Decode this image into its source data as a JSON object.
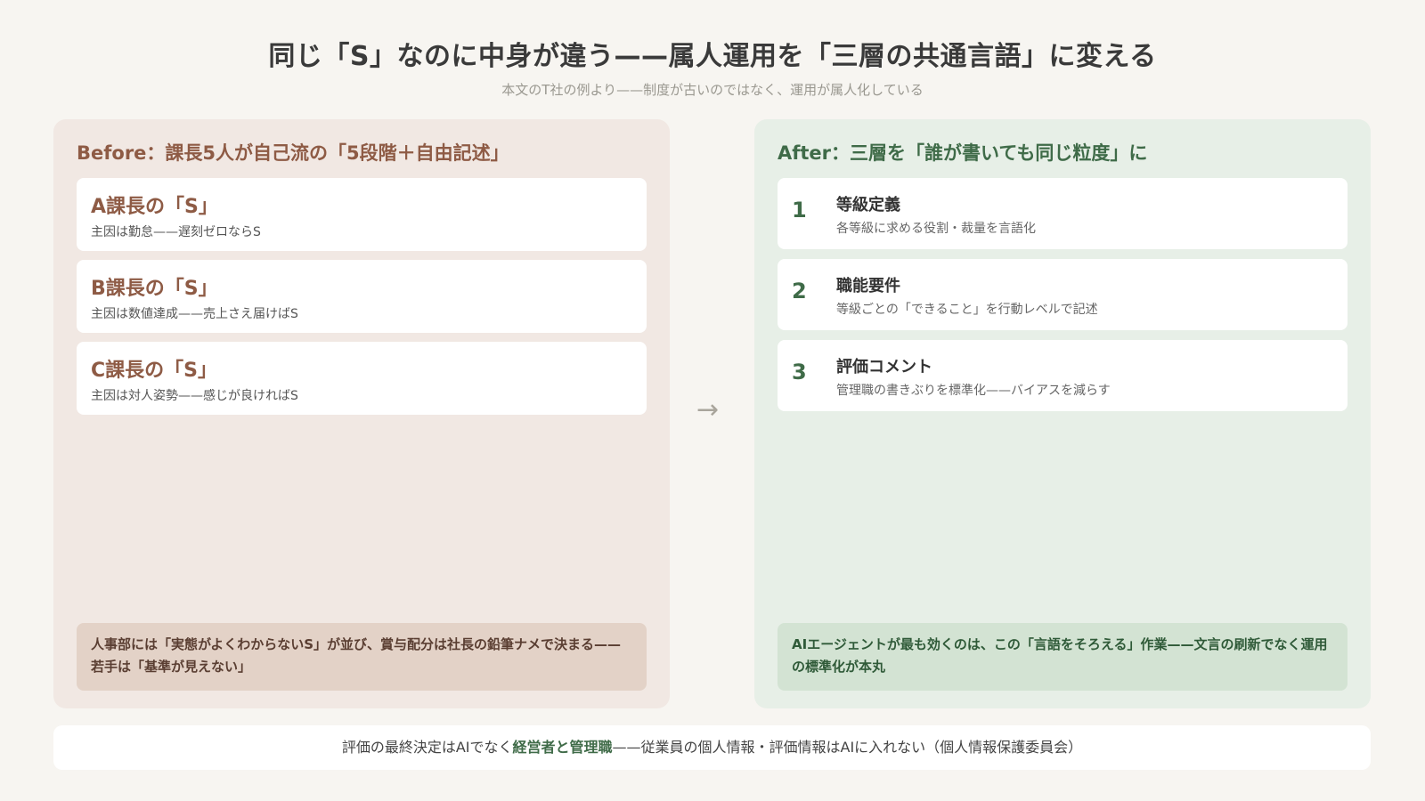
{
  "title": "同じ「S」なのに中身が違う——属人運用を「三層の共通言語」に変える",
  "subtitle": "本文のT社の例より——制度が古いのではなく、運用が属人化している",
  "before": {
    "heading": "Before：課長5人が自己流の「5段階＋自由記述」",
    "cards": [
      {
        "title": "A課長の「S」",
        "desc": "主因は勤怠——遅刻ゼロならS"
      },
      {
        "title": "B課長の「S」",
        "desc": "主因は数値達成——売上さえ届けばS"
      },
      {
        "title": "C課長の「S」",
        "desc": "主因は対人姿勢——感じが良ければS"
      }
    ],
    "note": "人事部には「実態がよくわからないS」が並び、賞与配分は社長の鉛筆ナメで決まる——若手は「基準が見えない」"
  },
  "arrow": "→",
  "after": {
    "heading": "After：三層を「誰が書いても同じ粒度」に",
    "steps": [
      {
        "num": "1",
        "title": "等級定義",
        "desc": "各等級に求める役割・裁量を言語化"
      },
      {
        "num": "2",
        "title": "職能要件",
        "desc": "等級ごとの「できること」を行動レベルで記述"
      },
      {
        "num": "3",
        "title": "評価コメント",
        "desc": "管理職の書きぶりを標準化——バイアスを減らす"
      }
    ],
    "note": "AIエージェントが最も効くのは、この「言語をそろえる」作業——文言の刷新でなく運用の標準化が本丸"
  },
  "footer": {
    "prefix": "評価の最終決定はAIでなく",
    "highlight": "経営者と管理職",
    "suffix": "——従業員の個人情報・評価情報はAIに入れない（個人情報保護委員会）"
  }
}
